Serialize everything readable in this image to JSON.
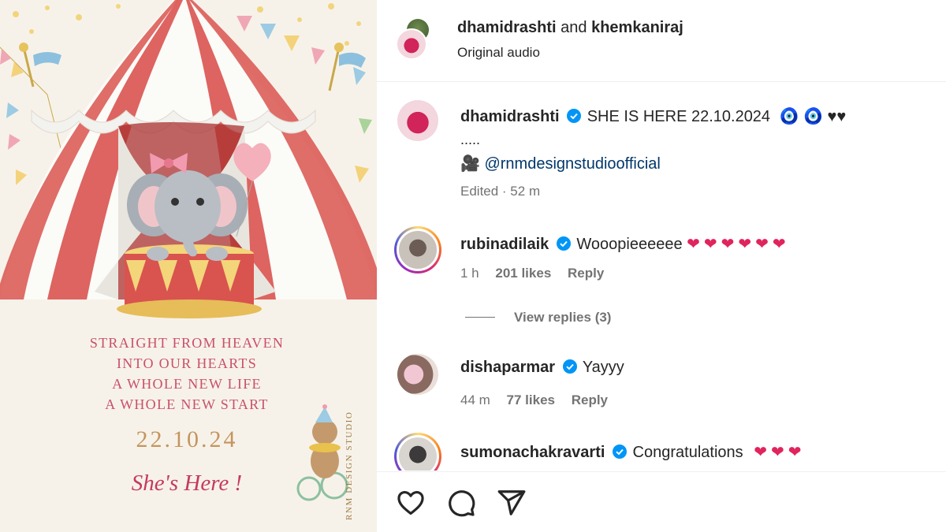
{
  "media": {
    "poem_lines": [
      "STRAIGHT FROM HEAVEN",
      "INTO OUR HEARTS",
      "A WHOLE NEW LIFE",
      "A WHOLE NEW START"
    ],
    "date": "22.10.24",
    "tagline": "She's Here !",
    "studio": "RNM DESIGN STUDIO"
  },
  "header": {
    "user1": "dhamidrashti",
    "connector": "and",
    "user2": "khemkaniraj",
    "audio": "Original audio"
  },
  "caption": {
    "user": "dhamidrashti",
    "text": "SHE IS HERE 22.10.2024",
    "emoji": "🧿 🧿 ♥♥",
    "dots": ".....",
    "camera_emoji": "🎥",
    "mention": "@rnmdesignstudioofficial",
    "meta": "Edited · 52 m"
  },
  "comments": [
    {
      "user": "rubinadilaik",
      "text": "Wooopieeeeee",
      "hearts": "❤❤❤❤❤❤",
      "time": "1 h",
      "likes": "201 likes",
      "reply": "Reply"
    },
    {
      "user": "dishaparmar",
      "text": "Yayyy",
      "hearts": "",
      "time": "44 m",
      "likes": "77 likes",
      "reply": "Reply"
    },
    {
      "user": "sumonachakravarti",
      "text": "Congratulations",
      "hearts": "❤❤❤"
    }
  ],
  "view_replies": "View replies (3)",
  "colors": {
    "verified": "#0095f6",
    "heart": "#e0245e",
    "tent_red": "#d9534f",
    "muted": "#737373"
  },
  "icons": {
    "like": "heart-icon",
    "comment": "comment-icon",
    "share": "share-icon"
  }
}
